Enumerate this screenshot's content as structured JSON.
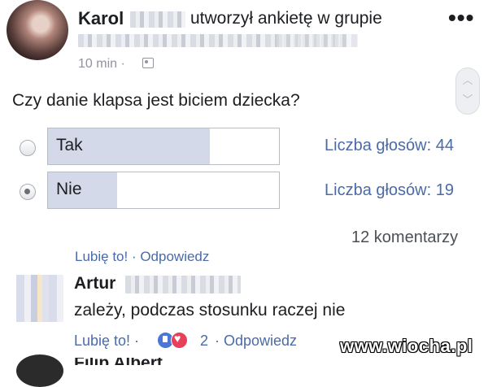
{
  "post": {
    "author": "Karol",
    "action": "utworzył ankietę w grupie",
    "time": "10 min ·",
    "question": "Czy danie klapsa jest biciem dziecka?",
    "comments_count": "12 komentarzy"
  },
  "poll": {
    "options": [
      {
        "label": "Tak",
        "votes": "Liczba głosów: 44",
        "selected": false
      },
      {
        "label": "Nie",
        "votes": "Liczba głosów: 19",
        "selected": true
      }
    ]
  },
  "comments": {
    "clipped_actions": "Lubię to! · Odpowiedz",
    "first": {
      "author": "Artur",
      "text": "zależy, podczas stosunku raczej nie",
      "like": "Lubię to! ·",
      "reaction_count": "2",
      "reply": "· Odpowiedz"
    },
    "second": {
      "author": "Filip Albert"
    }
  },
  "watermark": "www.wiocha.pl",
  "colors": {
    "link": "#4b6ba6",
    "poll_fill": "#d3d9e9"
  },
  "icons": [
    "more-options-icon",
    "audience-icon",
    "scroll-up-icon",
    "scroll-down-icon",
    "like-reaction-icon",
    "love-reaction-icon"
  ]
}
